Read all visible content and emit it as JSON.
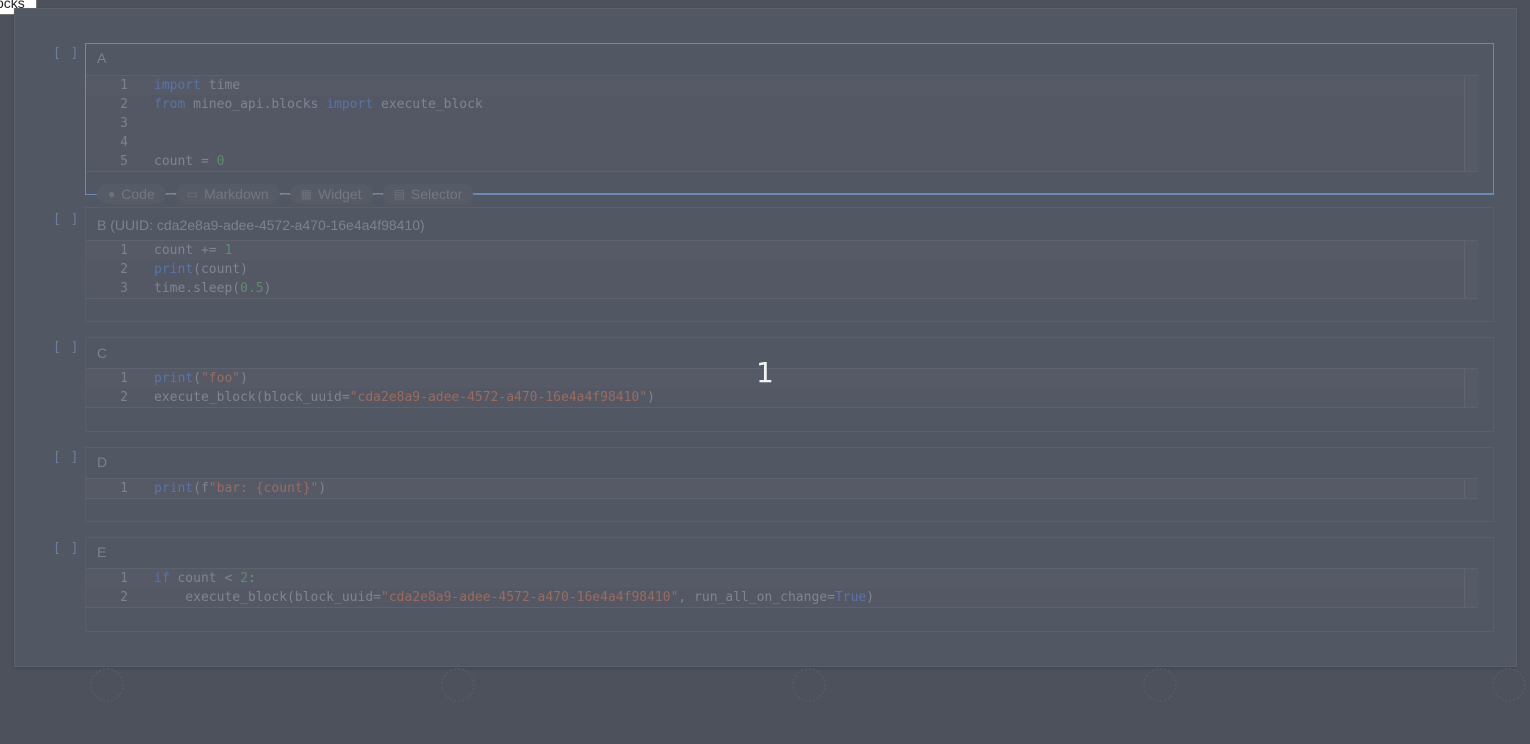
{
  "tooltip": {
    "text": "ocks"
  },
  "overlay": {
    "number": "1"
  },
  "toolbar": {
    "code_label": "Code",
    "markdown_label": "Markdown",
    "widget_label": "Widget",
    "selector_label": "Selector"
  },
  "cells": [
    {
      "prompt": "[ ]",
      "title": "A",
      "lines": [
        {
          "n": "1"
        },
        {
          "n": "2"
        },
        {
          "n": "3"
        },
        {
          "n": "4"
        },
        {
          "n": "5"
        }
      ]
    },
    {
      "prompt": "[ ]",
      "title": "B (UUID: cda2e8a9-adee-4572-a470-16e4a4f98410)",
      "lines": [
        {
          "n": "1"
        },
        {
          "n": "2"
        },
        {
          "n": "3"
        }
      ]
    },
    {
      "prompt": "[ ]",
      "title": "C",
      "lines": [
        {
          "n": "1"
        },
        {
          "n": "2"
        }
      ]
    },
    {
      "prompt": "[ ]",
      "title": "D",
      "lines": [
        {
          "n": "1"
        }
      ]
    },
    {
      "prompt": "[ ]",
      "title": "E",
      "lines": [
        {
          "n": "1"
        },
        {
          "n": "2"
        }
      ]
    }
  ],
  "code": {
    "a1_kw": "import",
    "a1_rest": " time",
    "a2_kw1": "from",
    "a2_mid": " mineo_api.blocks ",
    "a2_kw2": "import",
    "a2_rest": " execute_block",
    "a5_rest": "count = ",
    "a5_num": "0",
    "b1_rest": "count += ",
    "b1_num": "1",
    "b2_kw": "print",
    "b2_rest": "(count)",
    "b3_rest": "time.sleep(",
    "b3_num": "0.5",
    "b3_end": ")",
    "c1_kw": "print",
    "c1_open": "(",
    "c1_str": "\"foo\"",
    "c1_close": ")",
    "c2_rest": "execute_block(block_uuid=",
    "c2_str": "\"cda2e8a9-adee-4572-a470-16e4a4f98410\"",
    "c2_close": ")",
    "d1_kw": "print",
    "d1_open": "(f",
    "d1_str": "\"bar: {count}\"",
    "d1_close": ")",
    "e1_kw": "if",
    "e1_rest": " count < ",
    "e1_num": "2",
    "e1_end": ":",
    "e2_rest": "    execute_block(block_uuid=",
    "e2_str": "\"cda2e8a9-adee-4572-a470-16e4a4f98410\"",
    "e2_mid": ", run_all_on_change=",
    "e2_kw": "True",
    "e2_close": ")"
  },
  "icons": {
    "code": "python-icon",
    "markdown": "markdown-icon",
    "widget": "widget-grid-icon",
    "selector": "selector-icon"
  }
}
